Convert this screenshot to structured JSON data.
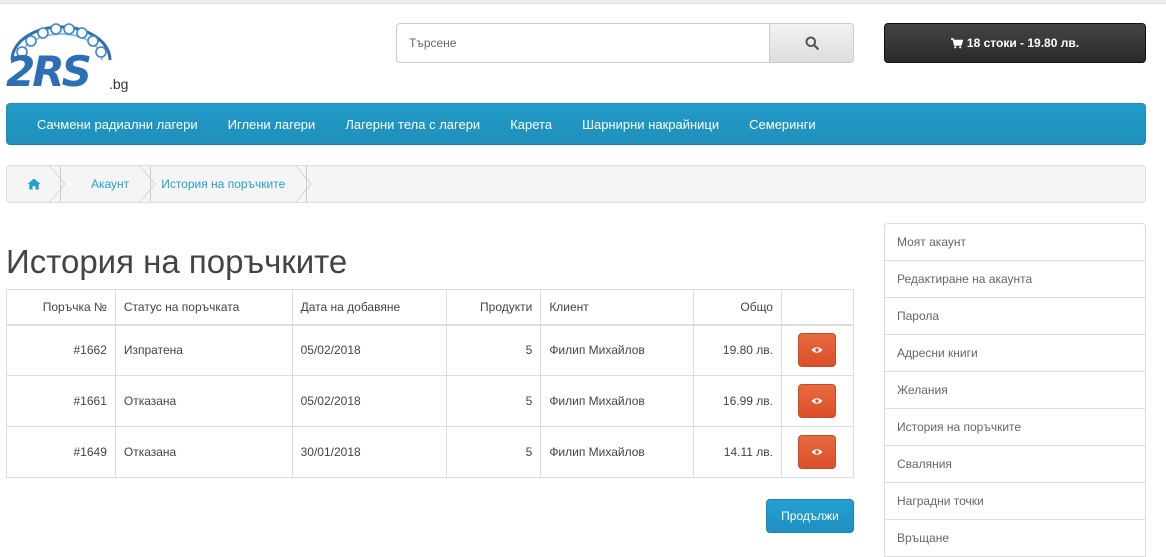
{
  "brand": {
    "logo_text": "2RS",
    "logo_suffix": ".bg"
  },
  "search": {
    "placeholder": "Търсене",
    "icon": "search-icon"
  },
  "cart": {
    "label": "18 стоки - 19.80 лв.",
    "icon": "shopping-cart-icon"
  },
  "menu": {
    "items": [
      {
        "label": "Сачмени радиални лагери"
      },
      {
        "label": "Иглени лагери"
      },
      {
        "label": "Лагерни тела с лагери"
      },
      {
        "label": "Карета"
      },
      {
        "label": "Шарнирни накрайници"
      },
      {
        "label": "Семеринги"
      }
    ]
  },
  "breadcrumb": {
    "home_icon": "home-icon",
    "items": [
      {
        "label": "Акаунт"
      },
      {
        "label": "История на поръчките"
      }
    ]
  },
  "page": {
    "title": "История на поръчките",
    "continue_label": "Продължи"
  },
  "orders": {
    "headers": {
      "id": "Поръчка №",
      "status": "Статус на поръчката",
      "date": "Дата на добавяне",
      "products": "Продукти",
      "customer": "Клиент",
      "total": "Общо"
    },
    "rows": [
      {
        "id": "#1662",
        "status": "Изпратена",
        "date": "05/02/2018",
        "products": "5",
        "customer": "Филип Михайлов",
        "total": "19.80 лв.",
        "action_icon": "eye-icon"
      },
      {
        "id": "#1661",
        "status": "Отказана",
        "date": "05/02/2018",
        "products": "5",
        "customer": "Филип Михайлов",
        "total": "16.99 лв.",
        "action_icon": "eye-icon"
      },
      {
        "id": "#1649",
        "status": "Отказана",
        "date": "30/01/2018",
        "products": "5",
        "customer": "Филип Михайлов",
        "total": "14.11 лв.",
        "action_icon": "eye-icon"
      }
    ]
  },
  "sidebar": {
    "items": [
      {
        "label": "Моят акаунт"
      },
      {
        "label": "Редактиране на акаунта"
      },
      {
        "label": "Парола"
      },
      {
        "label": "Адресни книги"
      },
      {
        "label": "Желания"
      },
      {
        "label": "История на поръчките"
      },
      {
        "label": "Сваляния"
      },
      {
        "label": "Наградни точки"
      },
      {
        "label": "Връщане"
      }
    ]
  },
  "colors": {
    "accent": "#229ac8",
    "danger": "#da4f2a",
    "link": "#23a1d1",
    "dark": "#303030"
  }
}
